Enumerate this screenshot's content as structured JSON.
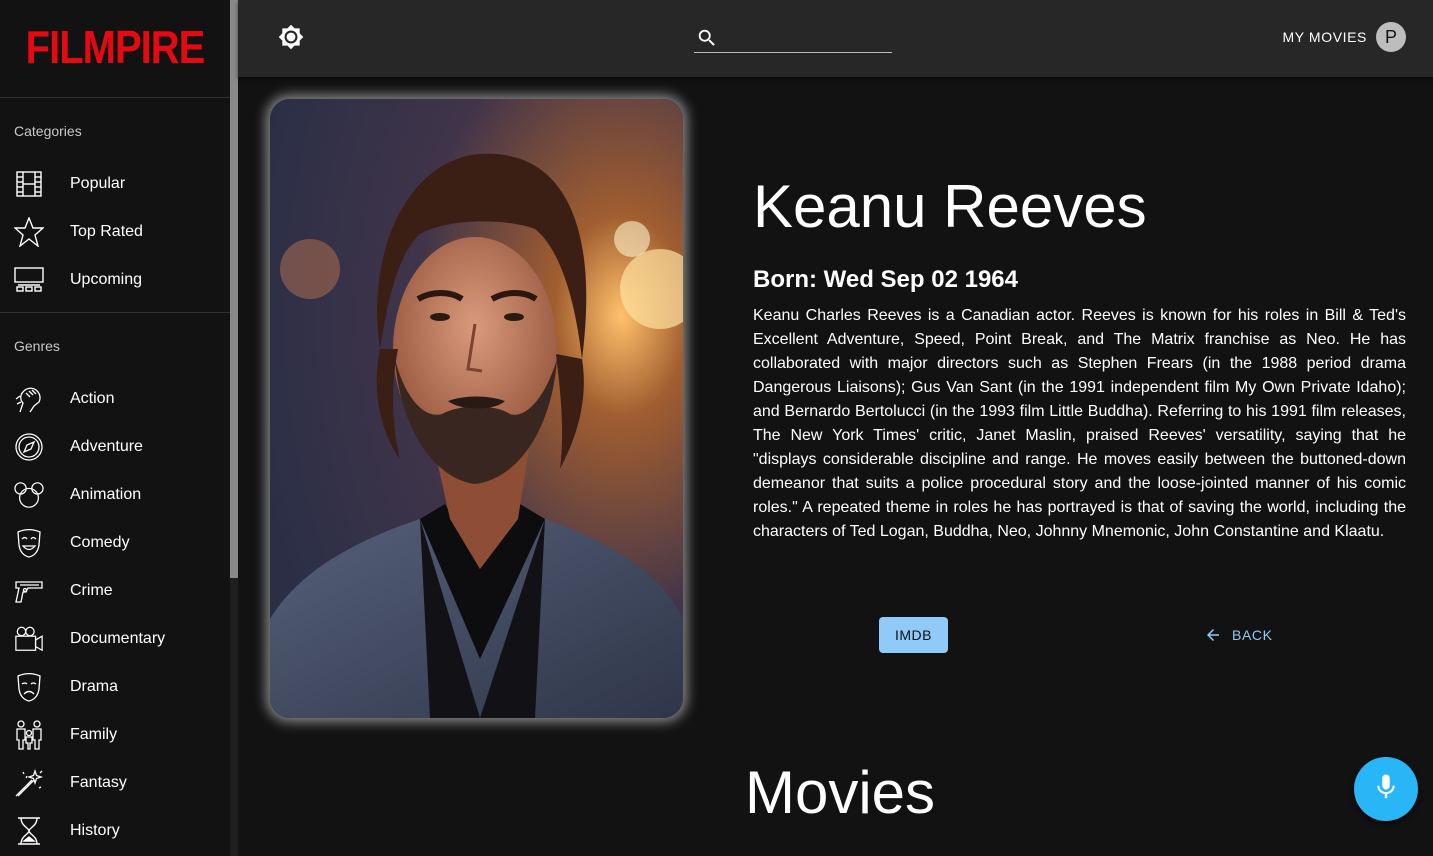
{
  "app": {
    "logo_text": "FILMPIRE",
    "brand_color": "#e50914",
    "accent_color": "#90caf9"
  },
  "sidebar": {
    "categories_header": "Categories",
    "categories": [
      {
        "label": "Popular",
        "icon": "film-icon"
      },
      {
        "label": "Top Rated",
        "icon": "star-icon"
      },
      {
        "label": "Upcoming",
        "icon": "theater-icon"
      }
    ],
    "genres_header": "Genres",
    "genres": [
      {
        "label": "Action",
        "icon": "fist-icon"
      },
      {
        "label": "Adventure",
        "icon": "compass-icon"
      },
      {
        "label": "Animation",
        "icon": "mouse-ears-icon"
      },
      {
        "label": "Comedy",
        "icon": "comedy-mask-icon"
      },
      {
        "label": "Crime",
        "icon": "gun-icon"
      },
      {
        "label": "Documentary",
        "icon": "camera-icon"
      },
      {
        "label": "Drama",
        "icon": "drama-mask-icon"
      },
      {
        "label": "Family",
        "icon": "family-icon"
      },
      {
        "label": "Fantasy",
        "icon": "magic-wand-icon"
      },
      {
        "label": "History",
        "icon": "hourglass-icon"
      }
    ]
  },
  "header": {
    "theme_icon": "brightness-icon",
    "search_placeholder": "",
    "my_movies_label": "MY MOVIES",
    "avatar_letter": "P"
  },
  "actor": {
    "name": "Keanu Reeves",
    "born": "Born: Wed Sep 02 1964",
    "biography": "Keanu Charles Reeves is a Canadian actor. Reeves is known for his roles in Bill & Ted's Excellent Adventure, Speed, Point Break, and The Matrix franchise as Neo. He has collaborated with major directors such as Stephen Frears (in the 1988 period drama Dangerous Liaisons); Gus Van Sant (in the 1991 independent film My Own Private Idaho); and Bernardo Bertolucci (in the 1993 film Little Buddha). Referring to his 1991 film releases, The New York Times' critic, Janet Maslin, praised Reeves' versatility, saying that he \"displays considerable discipline and range. He moves easily between the buttoned-down demeanor that suits a police procedural story and the loose-jointed manner of his comic roles.\" A repeated theme in roles he has portrayed is that of saving the world, including the characters of Ted Logan, Buddha, Neo, Johnny Mnemonic, John Constantine and Klaatu.",
    "imdb_label": "IMDB",
    "back_label": "BACK"
  },
  "movies_heading": "Movies",
  "voice_button_icon": "microphone-icon"
}
